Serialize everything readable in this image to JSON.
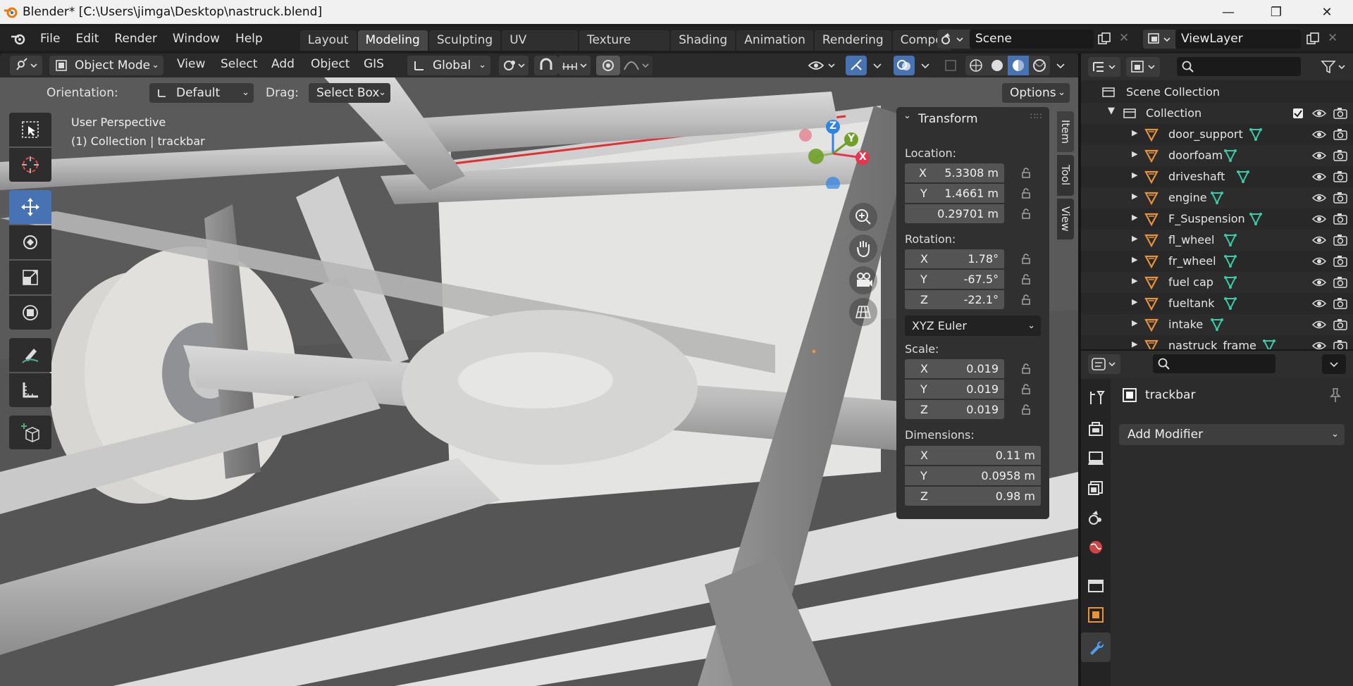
{
  "window": {
    "title": "Blender* [C:\\Users\\jimga\\Desktop\\nastruck.blend]",
    "minimize": "—",
    "maximize": "❐",
    "close": "✕"
  },
  "menubar": {
    "items": [
      "File",
      "Edit",
      "Render",
      "Window",
      "Help"
    ],
    "workspaces": [
      "Layout",
      "Modeling",
      "Sculpting",
      "UV Editing",
      "Texture Paint",
      "Shading",
      "Animation",
      "Rendering",
      "Compo"
    ],
    "active_workspace": "Modeling",
    "scene": "Scene",
    "view_layer": "ViewLayer"
  },
  "header": {
    "mode": "Object Mode",
    "menus": [
      "View",
      "Select",
      "Add",
      "Object",
      "GIS"
    ],
    "transform_orientation": "Global"
  },
  "tool_settings": {
    "orientation_label": "Orientation:",
    "orientation_value": "Default",
    "drag_label": "Drag:",
    "drag_value": "Select Box",
    "options": "Options"
  },
  "viewport": {
    "perspective": "User Perspective",
    "context": "(1) Collection | trackbar",
    "gizmo_axes": [
      "Z",
      "Y",
      "X"
    ]
  },
  "npanel": {
    "tabs": [
      "Item",
      "Tool",
      "View"
    ],
    "title": "Transform",
    "location_label": "Location:",
    "location": [
      {
        "axis": "X",
        "value": "5.3308 m"
      },
      {
        "axis": "Y",
        "value": "1.4661 m"
      },
      {
        "axis": "",
        "value": "0.29701 m"
      }
    ],
    "rotation_label": "Rotation:",
    "rotation": [
      {
        "axis": "X",
        "value": "1.78°"
      },
      {
        "axis": "Y",
        "value": "-67.5°"
      },
      {
        "axis": "Z",
        "value": "-22.1°"
      }
    ],
    "rotation_mode": "XYZ Euler",
    "scale_label": "Scale:",
    "scale": [
      {
        "axis": "X",
        "value": "0.019"
      },
      {
        "axis": "Y",
        "value": "0.019"
      },
      {
        "axis": "Z",
        "value": "0.019"
      }
    ],
    "dimensions_label": "Dimensions:",
    "dimensions": [
      {
        "axis": "X",
        "value": "0.11 m"
      },
      {
        "axis": "Y",
        "value": "0.0958 m"
      },
      {
        "axis": "Z",
        "value": "0.98 m"
      }
    ]
  },
  "outliner": {
    "scene_collection": "Scene Collection",
    "collection": "Collection",
    "items": [
      "door_support",
      "doorfoam",
      "driveshaft",
      "engine",
      "F_Suspension",
      "fl_wheel",
      "fr_wheel",
      "fuel cap",
      "fueltank",
      "intake",
      "nastruck_frame"
    ]
  },
  "properties": {
    "object_name": "trackbar",
    "add_modifier": "Add Modifier"
  },
  "colors": {
    "accent": "#4772b3",
    "panel": "#303030",
    "axis_x": "#e8364e",
    "axis_y": "#6fa02a",
    "axis_z": "#2f83e6",
    "object_orange": "#e8923a"
  }
}
